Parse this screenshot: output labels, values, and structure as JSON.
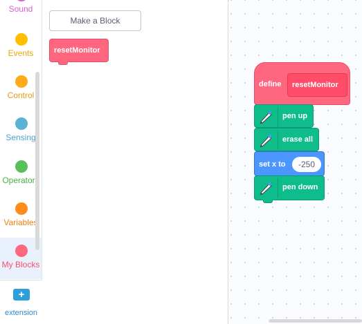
{
  "categories": [
    {
      "label": "Sound",
      "color": "#cf63cf",
      "text_color": "#cf63cf"
    },
    {
      "label": "Events",
      "color": "#ffbf00",
      "text_color": "#e6ac00"
    },
    {
      "label": "Control",
      "color": "#ffab19",
      "text_color": "#e69b14"
    },
    {
      "label": "Sensing",
      "color": "#5cb1d6",
      "text_color": "#4ca3c9"
    },
    {
      "label": "Operators",
      "color": "#59c059",
      "text_color": "#46b046"
    },
    {
      "label": "Variables",
      "color": "#ff8c1a",
      "text_color": "#f07f10"
    },
    {
      "label": "My Blocks",
      "color": "#ff6680",
      "text_color": "#ff4d6a"
    }
  ],
  "extension": {
    "label": "extension",
    "icon": "add-extension-icon"
  },
  "flyout": {
    "make_block_label": "Make a Block",
    "custom_block_label": "resetMonitor"
  },
  "script": {
    "define_label": "define",
    "define_name": "resetMonitor",
    "blocks": [
      {
        "label": "pen up",
        "icon": "pen-icon"
      },
      {
        "label": "erase all",
        "icon": "pen-icon"
      },
      {
        "label": "set x to",
        "value": "-250"
      },
      {
        "label": "pen down",
        "icon": "pen-icon"
      }
    ]
  },
  "colors": {
    "my_blocks": "#ff6680",
    "pen": "#0fbd8c",
    "motion": "#4c97ff"
  }
}
